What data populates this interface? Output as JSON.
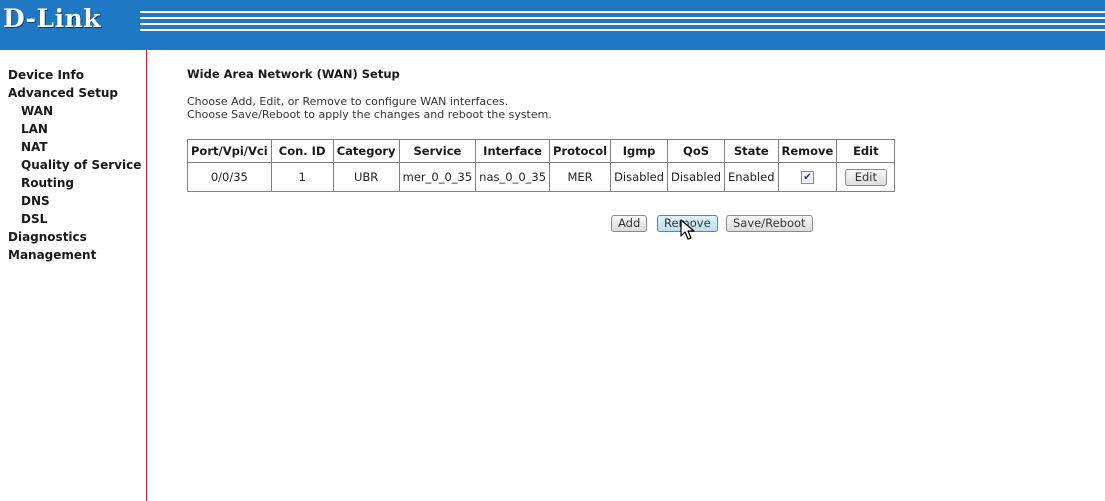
{
  "brand": {
    "logo": "D-Link"
  },
  "sidebar": {
    "items": [
      {
        "label": "Device Info",
        "level": 0
      },
      {
        "label": "Advanced Setup",
        "level": 0
      },
      {
        "label": "WAN",
        "level": 1
      },
      {
        "label": "LAN",
        "level": 1
      },
      {
        "label": "NAT",
        "level": 1
      },
      {
        "label": "Quality of Service",
        "level": 1
      },
      {
        "label": "Routing",
        "level": 1
      },
      {
        "label": "DNS",
        "level": 1
      },
      {
        "label": "DSL",
        "level": 1
      },
      {
        "label": "Diagnostics",
        "level": 0
      },
      {
        "label": "Management",
        "level": 0
      }
    ]
  },
  "main": {
    "title": "Wide Area Network (WAN) Setup",
    "desc_line1": "Choose Add, Edit, or Remove to configure WAN interfaces.",
    "desc_line2": "Choose Save/Reboot to apply the changes and reboot the system."
  },
  "table": {
    "headers": [
      "Port/Vpi/Vci",
      "Con. ID",
      "Category",
      "Service",
      "Interface",
      "Protocol",
      "Igmp",
      "QoS",
      "State",
      "Remove",
      "Edit"
    ],
    "rows": [
      {
        "port": "0/0/35",
        "con_id": "1",
        "category": "UBR",
        "service": "mer_0_0_35",
        "interface": "nas_0_0_35",
        "protocol": "MER",
        "igmp": "Disabled",
        "qos": "Disabled",
        "state": "Enabled",
        "remove_checked": true,
        "edit_label": "Edit"
      }
    ]
  },
  "actions": {
    "add_label": "Add",
    "remove_label": "Remove",
    "save_label": "Save/Reboot"
  },
  "colors": {
    "header_blue": "#1f78c3",
    "sidebar_border": "#cc2020"
  }
}
